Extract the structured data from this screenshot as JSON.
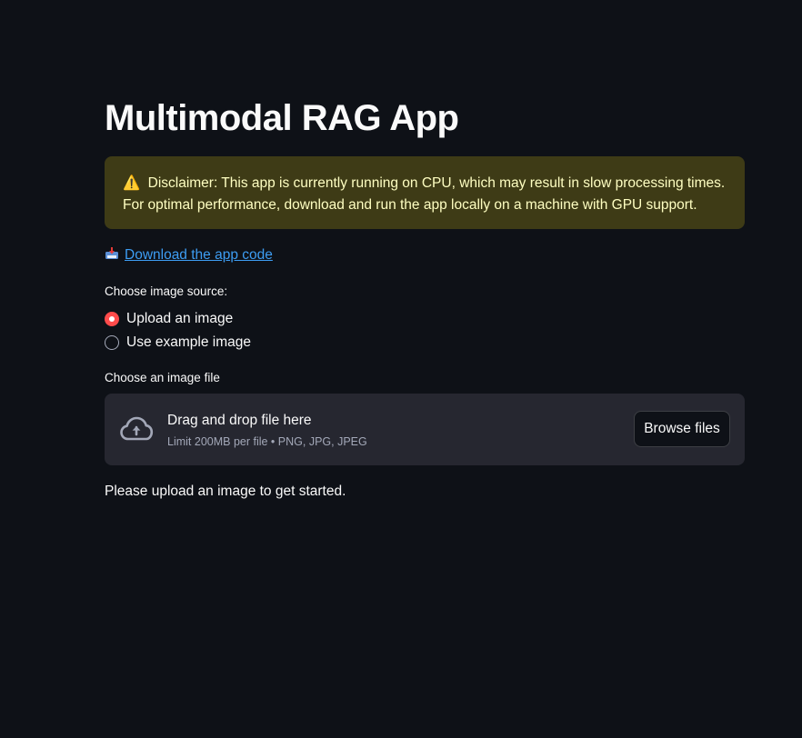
{
  "app": {
    "title": "Multimodal RAG App"
  },
  "warning": {
    "icon": "warning-icon",
    "text": "Disclaimer: This app is currently running on CPU, which may result in slow processing times. For optimal performance, download and run the app locally on a machine with GPU support."
  },
  "download": {
    "icon": "inbox-tray-icon",
    "label": "Download the app code"
  },
  "image_source": {
    "label": "Choose image source:",
    "options": [
      "Upload an image",
      "Use example image"
    ],
    "selected": "Upload an image"
  },
  "uploader": {
    "label": "Choose an image file",
    "icon": "cloud-upload-icon",
    "title": "Drag and drop file here",
    "limit": "Limit 200MB per file • PNG, JPG, JPEG",
    "button_label": "Browse files"
  },
  "info": {
    "text": "Please upload an image to get started."
  },
  "colors": {
    "background": "#0e1117",
    "accent": "#ff4b4b",
    "link": "#3d9df3",
    "warning_bg": "#3e3b16",
    "warning_text": "#ffffc2",
    "dropzone_bg": "#262730"
  }
}
